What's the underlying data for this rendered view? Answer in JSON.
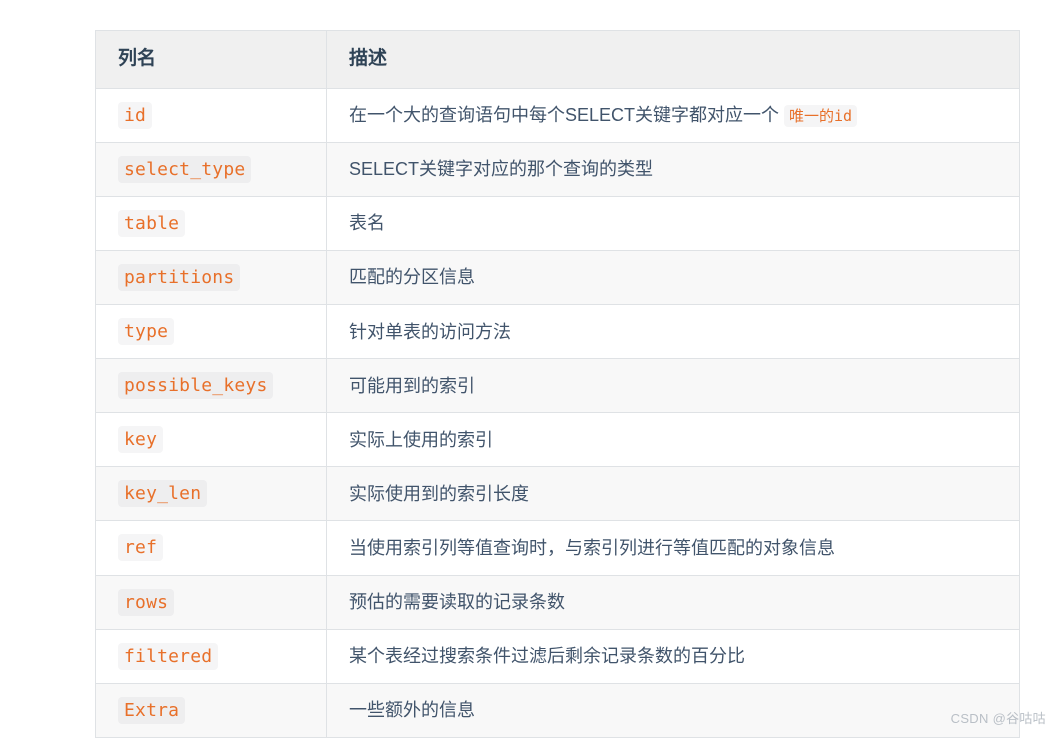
{
  "colors": {
    "code_orange": "#e8702a",
    "text_blue_gray": "#41546b",
    "header_bg": "#f0f0f0",
    "border": "#dfe2e5",
    "stripe_bg": "#f8f8f8",
    "watermark": "#b9bfc6"
  },
  "table": {
    "headers": {
      "name": "列名",
      "description": "描述"
    },
    "rows": [
      {
        "name": "id",
        "description_prefix": "在一个大的查询语句中每个SELECT关键字都对应一个 ",
        "description_code": "唯一的id",
        "description_suffix": ""
      },
      {
        "name": "select_type",
        "description_prefix": "SELECT关键字对应的那个查询的类型",
        "description_code": "",
        "description_suffix": ""
      },
      {
        "name": "table",
        "description_prefix": "表名",
        "description_code": "",
        "description_suffix": ""
      },
      {
        "name": "partitions",
        "description_prefix": "匹配的分区信息",
        "description_code": "",
        "description_suffix": ""
      },
      {
        "name": "type",
        "description_prefix": "针对单表的访问方法",
        "description_code": "",
        "description_suffix": ""
      },
      {
        "name": "possible_keys",
        "description_prefix": "可能用到的索引",
        "description_code": "",
        "description_suffix": ""
      },
      {
        "name": "key",
        "description_prefix": "实际上使用的索引",
        "description_code": "",
        "description_suffix": ""
      },
      {
        "name": "key_len",
        "description_prefix": "实际使用到的索引长度",
        "description_code": "",
        "description_suffix": ""
      },
      {
        "name": "ref",
        "description_prefix": "当使用索引列等值查询时，与索引列进行等值匹配的对象信息",
        "description_code": "",
        "description_suffix": ""
      },
      {
        "name": "rows",
        "description_prefix": "预估的需要读取的记录条数",
        "description_code": "",
        "description_suffix": ""
      },
      {
        "name": "filtered",
        "description_prefix": "某个表经过搜索条件过滤后剩余记录条数的百分比",
        "description_code": "",
        "description_suffix": ""
      },
      {
        "name": "Extra",
        "description_prefix": "一些额外的信息",
        "description_code": "",
        "description_suffix": ""
      }
    ]
  },
  "watermark": {
    "text": "CSDN @谷咕咕"
  }
}
